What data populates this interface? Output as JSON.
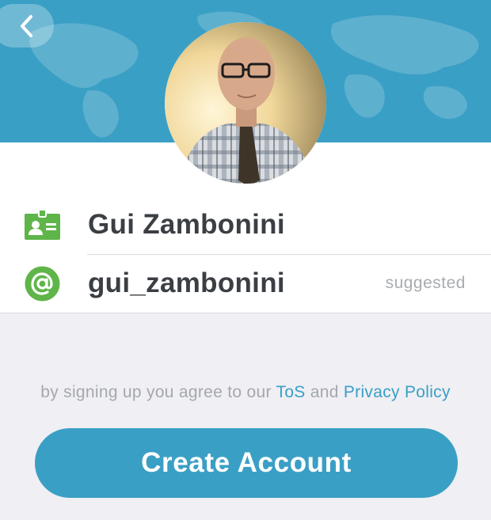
{
  "header": {
    "back_icon": "chevron-left-icon",
    "accent_color": "#3a9fc5"
  },
  "profile": {
    "avatar_icon": "profile-photo",
    "name_icon": "id-badge-icon",
    "name_value": "Gui Zambonini",
    "username_icon": "at-sign-icon",
    "username_value": "gui_zambonini",
    "username_hint": "suggested"
  },
  "terms": {
    "prefix": "by signing up you agree to our",
    "tos_link": "ToS",
    "joiner": "and",
    "privacy_link": "Privacy Policy"
  },
  "actions": {
    "create_label": "Create Account"
  },
  "colors": {
    "background": "#efeff4",
    "icon_green": "#5fb549",
    "text_dark": "#3b3f44",
    "text_muted": "#a4a8ae"
  }
}
